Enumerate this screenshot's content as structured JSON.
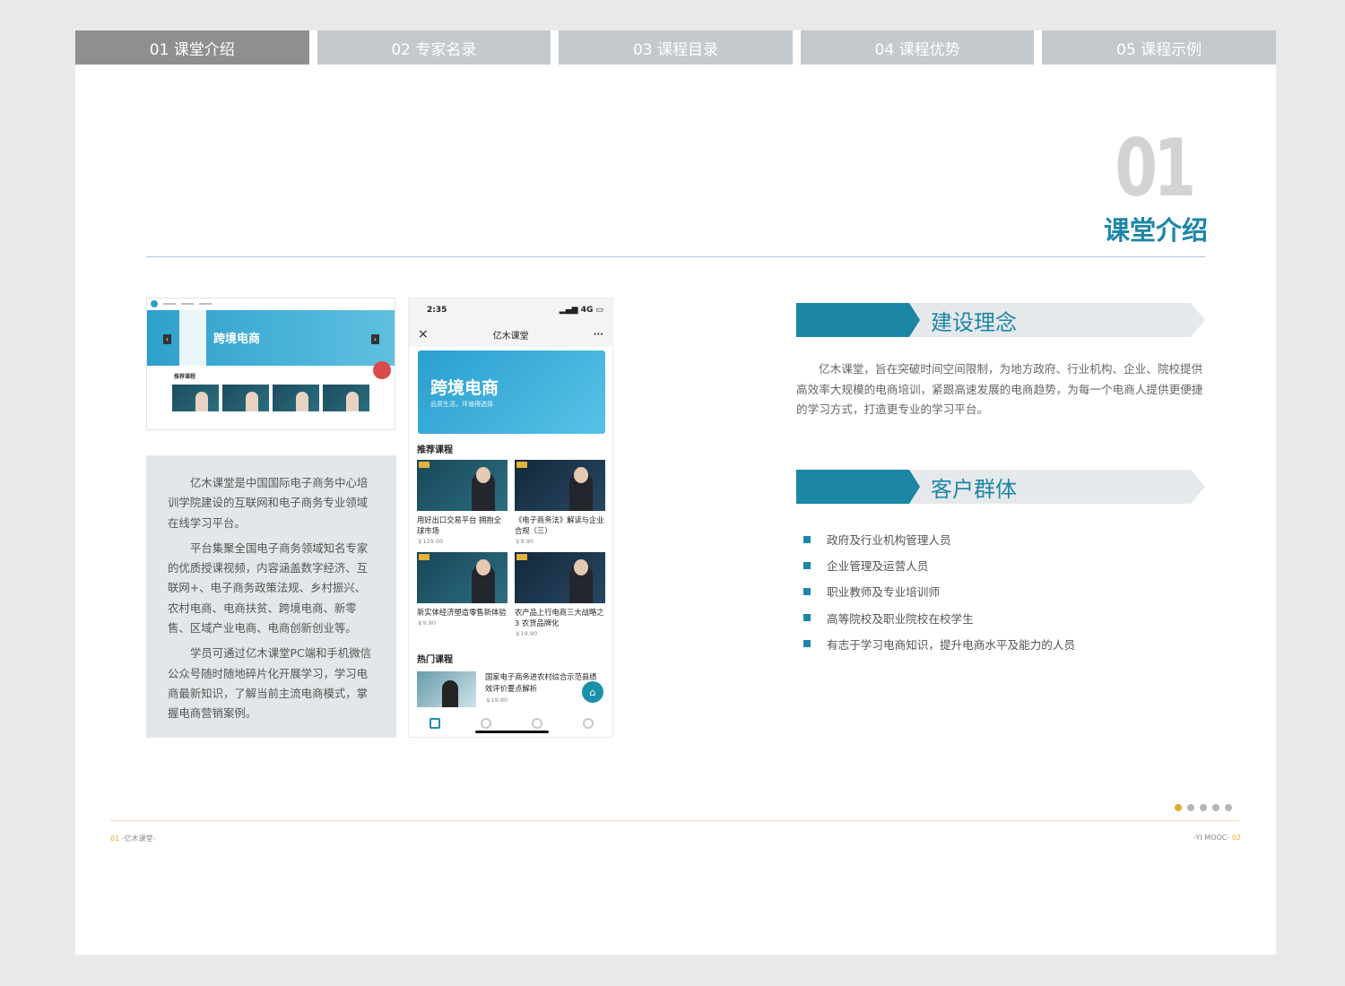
{
  "tabs": [
    {
      "label": "01 课堂介绍",
      "active": true
    },
    {
      "label": "02 专家名录",
      "active": false
    },
    {
      "label": "03 课程目录",
      "active": false
    },
    {
      "label": "04 课程优势",
      "active": false
    },
    {
      "label": "05 课程示例",
      "active": false
    }
  ],
  "heading": {
    "number": "01",
    "title": "课堂介绍"
  },
  "pc_screenshot": {
    "banner_title": "跨境电商",
    "section_label": "推荐课程"
  },
  "intro_paragraphs": [
    "亿木课堂是中国国际电子商务中心培训学院建设的互联网和电子商务专业领域在线学习平台。",
    "平台集聚全国电子商务领域知名专家的优质授课视频，内容涵盖数字经济、互联网+、电子商务政策法规、乡村振兴、农村电商、电商扶贫、跨境电商、新零售、区域产业电商、电商创新创业等。",
    "学员可通过亿木课堂PC端和手机微信公众号随时随地碎片化开展学习，学习电商最新知识，了解当前主流电商模式，掌握电商营销案例。"
  ],
  "phone": {
    "time": "2:35",
    "signal": "4G",
    "close_icon": "×",
    "title": "亿木课堂",
    "more_icon": "···",
    "banner_title": "跨境电商",
    "banner_sub": "品质生活，坪值得选择",
    "recommended_label": "推荐课程",
    "courses": [
      {
        "title": "用好出口交易平台 拥抱全球市场",
        "price": "￥129.00"
      },
      {
        "title": "《电子商务法》解读与企业合规（三）",
        "price": "￥9.90"
      },
      {
        "title": "新实体经济塑造零售新体验",
        "price": "￥9.90"
      },
      {
        "title": "农产品上行电商三大战略之3 农货品牌化",
        "price": "￥19.90"
      }
    ],
    "hot_label": "热门课程",
    "hot_course": {
      "title": "国家电子商务进农村综合示范县绩效评价要点解析",
      "price": "￥19.90"
    }
  },
  "concept": {
    "title": "建设理念",
    "text": "亿木课堂，旨在突破时间空间限制，为地方政府、行业机构、企业、院校提供高效率大规模的电商培训，紧跟高速发展的电商趋势，为每一个电商人提供更便捷的学习方式，打造更专业的学习平台。"
  },
  "clients": {
    "title": "客户群体",
    "items": [
      "政府及行业机构管理人员",
      "企业管理及运营人员",
      "职业教师及专业培训师",
      "高等院校及职业院校在校学生",
      "有志于学习电商知识，提升电商水平及能力的人员"
    ]
  },
  "pager": {
    "total": 5,
    "current": 1
  },
  "footer": {
    "left_num": "01",
    "left_text": "-亿木课堂-",
    "right_text": "-YI MOOC-",
    "right_num": "02"
  },
  "colors": {
    "accent_blue": "#1d86a6",
    "tab_active": "#8f8f8f",
    "tab_inactive": "#c3c9cd",
    "gold": "#e3a92a"
  }
}
